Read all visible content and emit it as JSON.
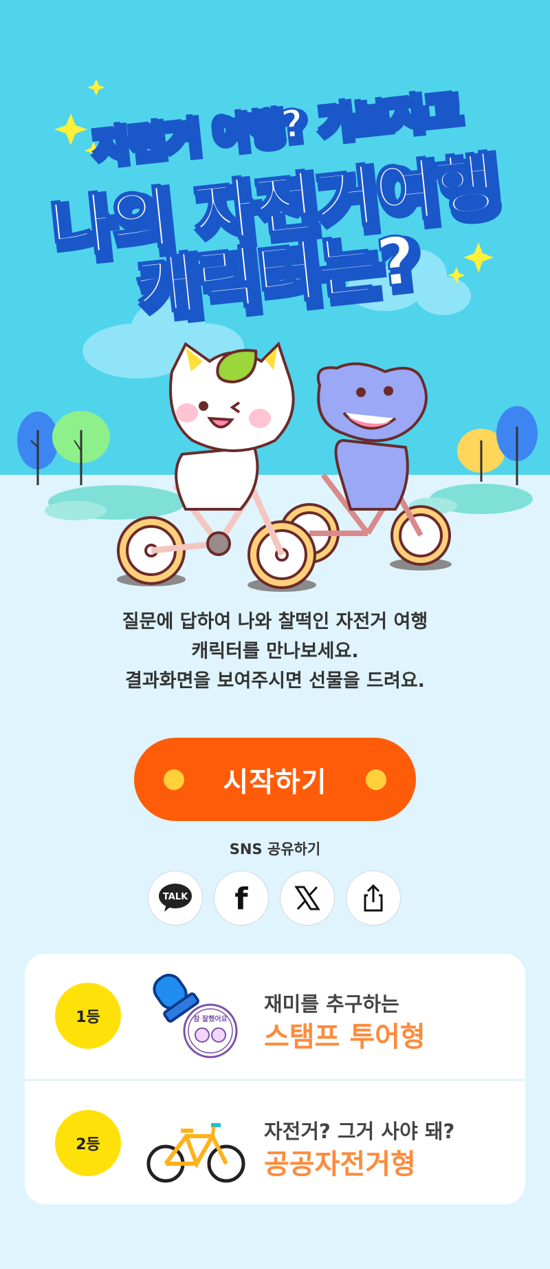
{
  "hero": {
    "title_line1": "자전거 여행? 가보자고",
    "title_line2": "나의 자전거여행",
    "title_line3": "캐릭터는?"
  },
  "description": {
    "line1": "질문에 답하여 나와 찰떡인 자전거 여행",
    "line2": "캐릭터를 만나보세요.",
    "line3": "결과화면을 보여주시면 선물을 드려요."
  },
  "start_button": {
    "label": "시작하기"
  },
  "share": {
    "label": "SNS 공유하기",
    "buttons": [
      {
        "icon": "kakaotalk-icon",
        "text": "TALK"
      },
      {
        "icon": "facebook-icon",
        "text": "f"
      },
      {
        "icon": "x-icon",
        "text": "X"
      },
      {
        "icon": "share-icon",
        "text": ""
      }
    ]
  },
  "ranking": [
    {
      "rank": "1등",
      "subtitle": "재미를 추구하는",
      "title": "스탬프 투어형",
      "icon": "stamp-icon",
      "stamp_text": "참 잘했어요"
    },
    {
      "rank": "2등",
      "subtitle": "자전거? 그거 사야 돼?",
      "title": "공공자전거형",
      "icon": "bicycle-icon"
    }
  ],
  "colors": {
    "sky": "#4fd4ec",
    "ground": "#dff4fd",
    "start_button": "#ff5c0a",
    "dot": "#ffd03a",
    "badge": "#ffe10a",
    "rank_title": "#ff8a3a"
  }
}
